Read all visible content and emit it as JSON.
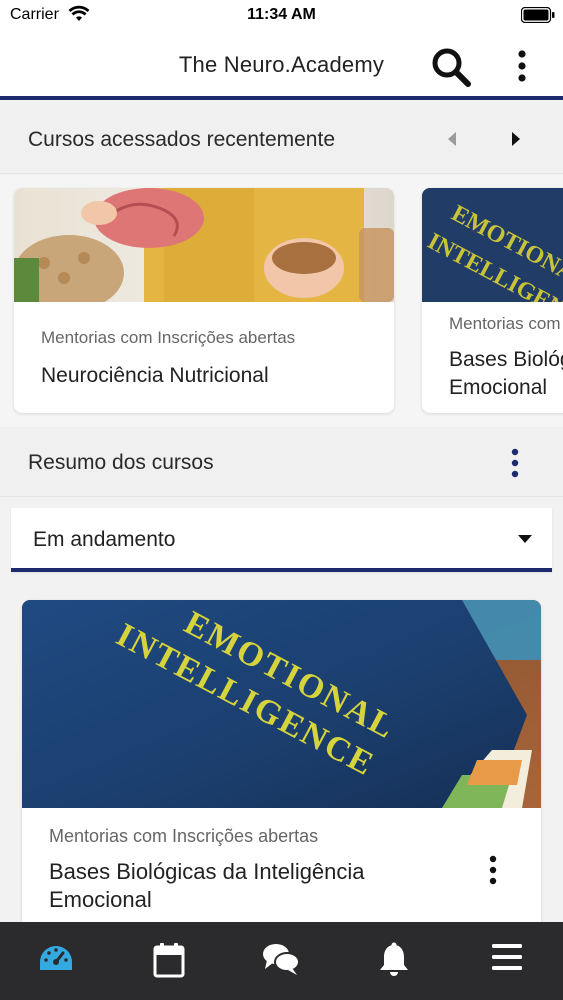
{
  "status_bar": {
    "carrier": "Carrier",
    "time": "11:34 AM"
  },
  "app_bar": {
    "title": "The Neuro.Academy"
  },
  "recent": {
    "title": "Cursos acessados recentemente",
    "cards": [
      {
        "category": "Mentorias com Inscrições abertas",
        "name": "Neurociência Nutricional"
      },
      {
        "category": "Mentorias com Inscrições abertas",
        "name_line1": "Bases Biológicas da Inteligência",
        "name_line2": "Emocional"
      }
    ]
  },
  "summary": {
    "title": "Resumo dos cursos",
    "filter": {
      "selected": "Em andamento"
    }
  },
  "course": {
    "image_text_line1": "EMOTIONAL",
    "image_text_line2": "INTELLIGENCE",
    "category": "Mentorias com Inscrições abertas",
    "name": "Bases Biológicas da Inteligência Emocional"
  },
  "colors": {
    "accent": "#1e2a6e",
    "nav_bg": "#2b2b2d",
    "nav_active": "#33a9e0",
    "nav_icon": "#ffffff"
  },
  "bottom_nav": [
    "dashboard-icon",
    "calendar-icon",
    "chat-icon",
    "bell-icon",
    "menu-icon"
  ]
}
